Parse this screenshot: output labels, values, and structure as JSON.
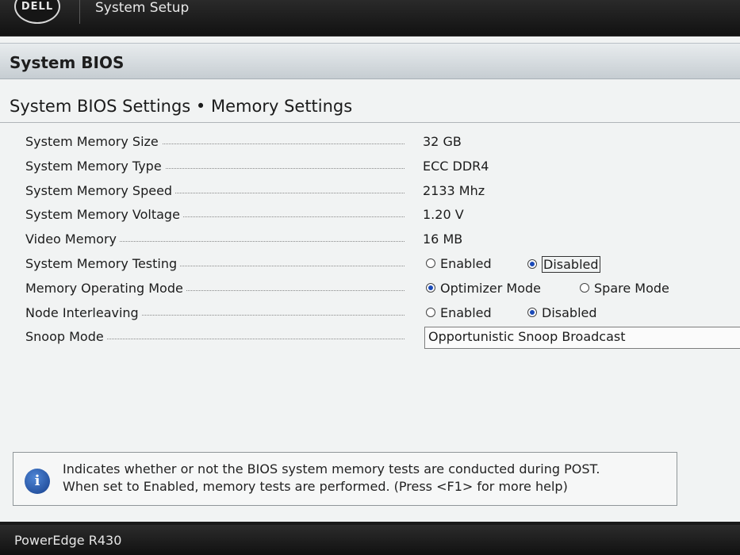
{
  "header": {
    "logo_text": "DELL",
    "app_title": "System Setup"
  },
  "section": {
    "title": "System BIOS",
    "breadcrumb": "System BIOS Settings • Memory Settings"
  },
  "settings": [
    {
      "label": "System Memory Size",
      "value": "32 GB"
    },
    {
      "label": "System Memory Type",
      "value": "ECC DDR4"
    },
    {
      "label": "System Memory Speed",
      "value": "2133 Mhz"
    },
    {
      "label": "System Memory Voltage",
      "value": "1.20 V"
    },
    {
      "label": "Video Memory",
      "value": "16 MB"
    },
    {
      "label": "System Memory Testing",
      "options": [
        "Enabled",
        "Disabled"
      ],
      "selected": "Disabled"
    },
    {
      "label": "Memory Operating Mode",
      "options": [
        "Optimizer Mode",
        "Spare Mode"
      ],
      "selected": "Optimizer Mode"
    },
    {
      "label": "Node Interleaving",
      "options": [
        "Enabled",
        "Disabled"
      ],
      "selected": "Disabled"
    },
    {
      "label": "Snoop Mode",
      "dropdown_value": "Opportunistic Snoop Broadcast"
    }
  ],
  "help": {
    "icon": "info-icon",
    "line1": "Indicates whether or not the BIOS system memory tests are conducted during POST.",
    "line2": "When set to Enabled, memory tests are performed. (Press <F1> for more help)"
  },
  "footer": {
    "model": "PowerEdge R430"
  }
}
